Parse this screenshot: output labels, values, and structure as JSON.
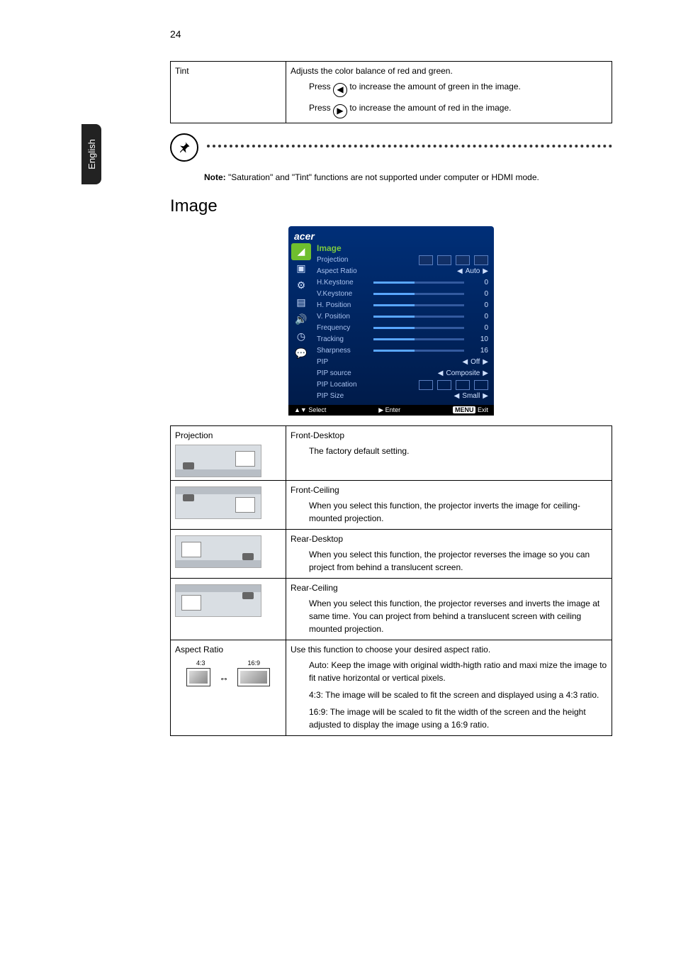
{
  "pageNumber": "24",
  "sideTab": "English",
  "tintTable": {
    "label": "Tint",
    "desc": "Adjusts the color balance of red and green.",
    "pressLeft_a": "Press ",
    "pressLeft_b": " to increase the amount of green in the image.",
    "pressRight_a": "Press ",
    "pressRight_b": " to increase the amount of red in the image."
  },
  "note": {
    "bold": "Note:",
    "text": " \"Saturation\" and \"Tint\" functions are not supported under computer or HDMI mode."
  },
  "sectionTitle": "Image",
  "osd": {
    "brand": "acer",
    "title": "Image",
    "rows": {
      "projection": "Projection",
      "aspect": "Aspect Ratio",
      "aspectVal": "Auto",
      "hkey": "H.Keystone",
      "vkey": "V.Keystone",
      "hpos": "H. Position",
      "vpos": "V. Position",
      "freq": "Frequency",
      "track": "Tracking",
      "sharp": "Sharpness",
      "pip": "PIP",
      "pipVal": "Off",
      "pipSrc": "PIP source",
      "pipSrcVal": "Composite",
      "pipLoc": "PIP Location",
      "pipSize": "PIP Size",
      "pipSizeVal": "Small",
      "n0a": "0",
      "n0b": "0",
      "n0c": "0",
      "n0d": "0",
      "n0e": "0",
      "n10": "10",
      "n16": "16"
    },
    "footSelect": "▲▼ Select",
    "footEnter": "▶ Enter",
    "footMenu": "MENU",
    "footExit": "Exit"
  },
  "projTable": {
    "projection": "Projection",
    "fd_title": "Front-Desktop",
    "fd_desc": "The factory default setting.",
    "fc_title": "Front-Ceiling",
    "fc_desc": "When you select this function, the projector inverts the image for ceiling-mounted projection.",
    "rd_title": "Rear-Desktop",
    "rd_desc": "When you select this function, the projector reverses the image so you can project from behind a translucent screen.",
    "rc_title": "Rear-Ceiling",
    "rc_desc": "When you select this function, the projector reverses and inverts the image at same time. You can project from behind a translucent screen with ceiling mounted projection.",
    "aspect": "Aspect Ratio",
    "label43": "4:3",
    "label169": "16:9",
    "aspect_intro": "Use this function to choose your desired aspect ratio.",
    "auto_line": "Auto: Keep the image with original width-higth ratio and maxi mize the image to fit native horizontal or vertical pixels.",
    "l43_line": "4:3: The image will be scaled to fit the screen and displayed using a 4:3 ratio.",
    "l169_line": "16:9: The image will be scaled to fit the width of the screen and the height adjusted to display the image using a 16:9 ratio."
  }
}
